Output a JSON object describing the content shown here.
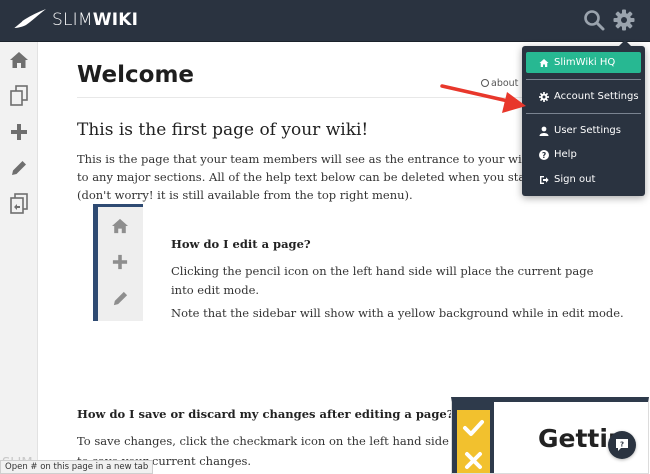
{
  "app": {
    "logo_light": "SLIM",
    "logo_bold": "WIKI"
  },
  "topbar": {
    "icons": [
      "search-icon",
      "gear-icon"
    ]
  },
  "sidebar": {
    "items": [
      {
        "icon": "home-icon"
      },
      {
        "icon": "pages-icon"
      },
      {
        "icon": "add-icon"
      },
      {
        "icon": "pencil-icon"
      },
      {
        "icon": "copy-page-icon"
      }
    ],
    "faint_label": "SLIM"
  },
  "page": {
    "title": "Welcome",
    "meta": "about 3",
    "heading": "This is the first page of your wiki!",
    "intro_lines": [
      "This is the page that your team members will see as the entrance to your wiki and shoul",
      "to any major sections.  All of the help text below can be deleted when you start to build y",
      "(don't worry! it is still available from the top right menu)."
    ],
    "edit_question": "How do I edit a page?",
    "edit_answer": "Clicking the pencil icon on the left hand side will place the current page into edit mode.",
    "edit_note": "Note that the sidebar will show with a yellow background while in edit mode.",
    "save_question": "How do I save or discard my changes after editing a page?",
    "save_answer": "To save changes,  click the checkmark icon on the left hand side to save your current changes.",
    "getting_title": "Gettin"
  },
  "dropdown": {
    "items": [
      {
        "label": "SlimWiki HQ",
        "icon": "home-icon"
      },
      {
        "label": "Account Settings",
        "icon": "gear-icon"
      },
      {
        "label": "User Settings",
        "icon": "user-icon"
      },
      {
        "label": "Help",
        "icon": "question-icon"
      },
      {
        "label": "Sign out",
        "icon": "sign-out-icon"
      }
    ]
  },
  "status_bar": {
    "text": "Open # on this page in a new tab"
  },
  "colors": {
    "topbar": "#2a3340",
    "accent": "#27b892",
    "card_border": "#2e4a72",
    "highlight": "#f2c12e",
    "arrow": "#e8372b"
  }
}
